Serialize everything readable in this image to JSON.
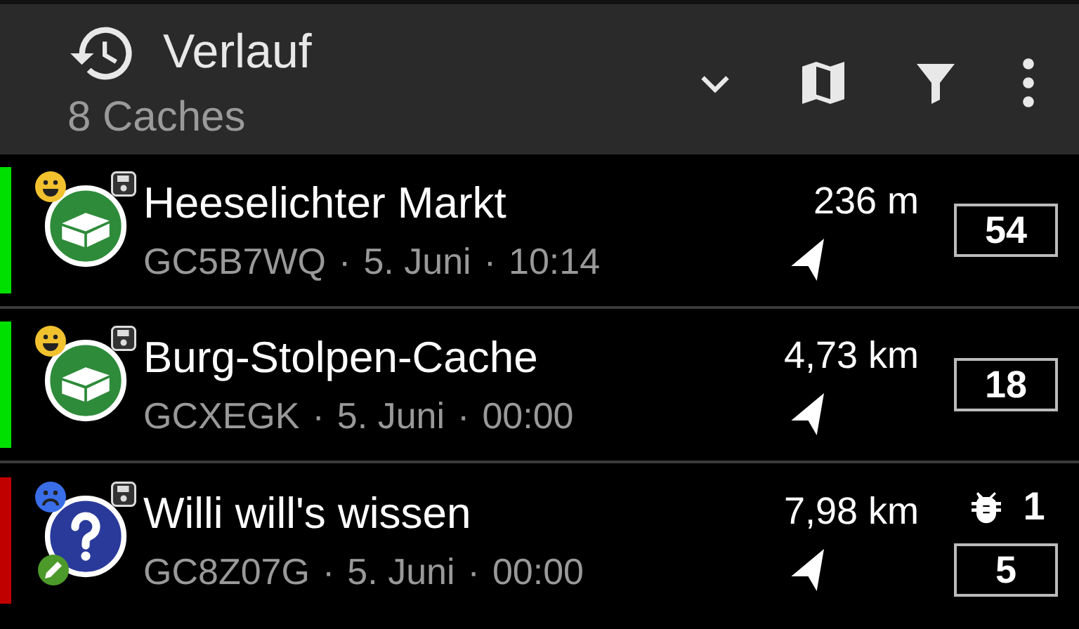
{
  "toolbar": {
    "title": "Verlauf",
    "subtitle": "8 Caches"
  },
  "caches": [
    {
      "name": "Heeselichter Markt",
      "code": "GC5B7WQ",
      "date": "5. Juni",
      "time": "10:14",
      "separator": "·",
      "distance": "236 m",
      "favorites": "54",
      "color": "#00e000",
      "kind": "traditional",
      "found": true,
      "stored": true,
      "edited": false
    },
    {
      "name": "Burg-Stolpen-Cache",
      "code": "GCXEGK",
      "date": "5. Juni",
      "time": "00:00",
      "separator": "·",
      "distance": "4,73 km",
      "favorites": "18",
      "color": "#00e000",
      "kind": "traditional",
      "found": true,
      "stored": true,
      "edited": false
    },
    {
      "name": "Willi will's wissen",
      "code": "GC8Z07G",
      "date": "5. Juni",
      "time": "00:00",
      "separator": "·",
      "distance": "7,98 km",
      "favorites": "5",
      "trackables": "1",
      "color": "#c00000",
      "kind": "mystery",
      "found": false,
      "stored": true,
      "edited": true
    }
  ]
}
